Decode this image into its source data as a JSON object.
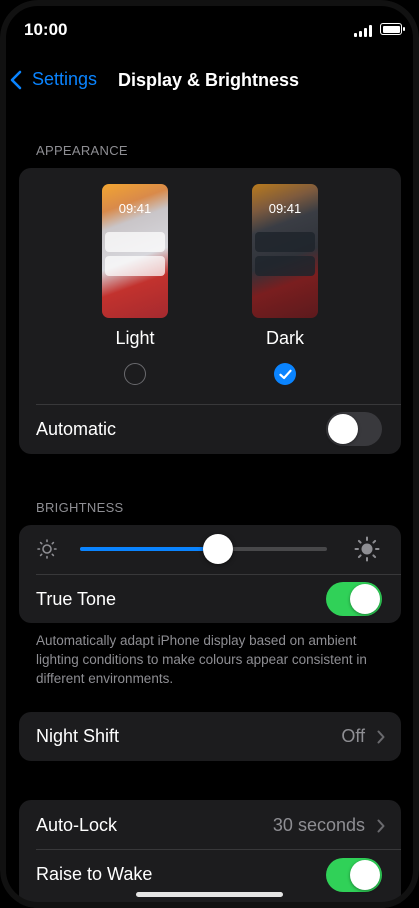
{
  "status": {
    "time": "10:00"
  },
  "nav": {
    "back_label": "Settings",
    "title": "Display & Brightness"
  },
  "appearance": {
    "section_label": "APPEARANCE",
    "options": [
      {
        "label": "Light",
        "preview_time": "09:41",
        "selected": false
      },
      {
        "label": "Dark",
        "preview_time": "09:41",
        "selected": true
      }
    ],
    "automatic": {
      "label": "Automatic",
      "on": false
    }
  },
  "brightness": {
    "section_label": "BRIGHTNESS",
    "level": 0.56,
    "true_tone": {
      "label": "True Tone",
      "on": true
    },
    "footnote": "Automatically adapt iPhone display based on ambient lighting conditions to make colours appear consistent in different environments."
  },
  "night_shift": {
    "label": "Night Shift",
    "value": "Off"
  },
  "lock": {
    "auto_lock": {
      "label": "Auto-Lock",
      "value": "30 seconds"
    },
    "raise_to_wake": {
      "label": "Raise to Wake",
      "on": true
    }
  },
  "colors": {
    "accent": "#0a84ff",
    "toggle_on": "#30d158",
    "group_bg": "#1c1c1e"
  }
}
